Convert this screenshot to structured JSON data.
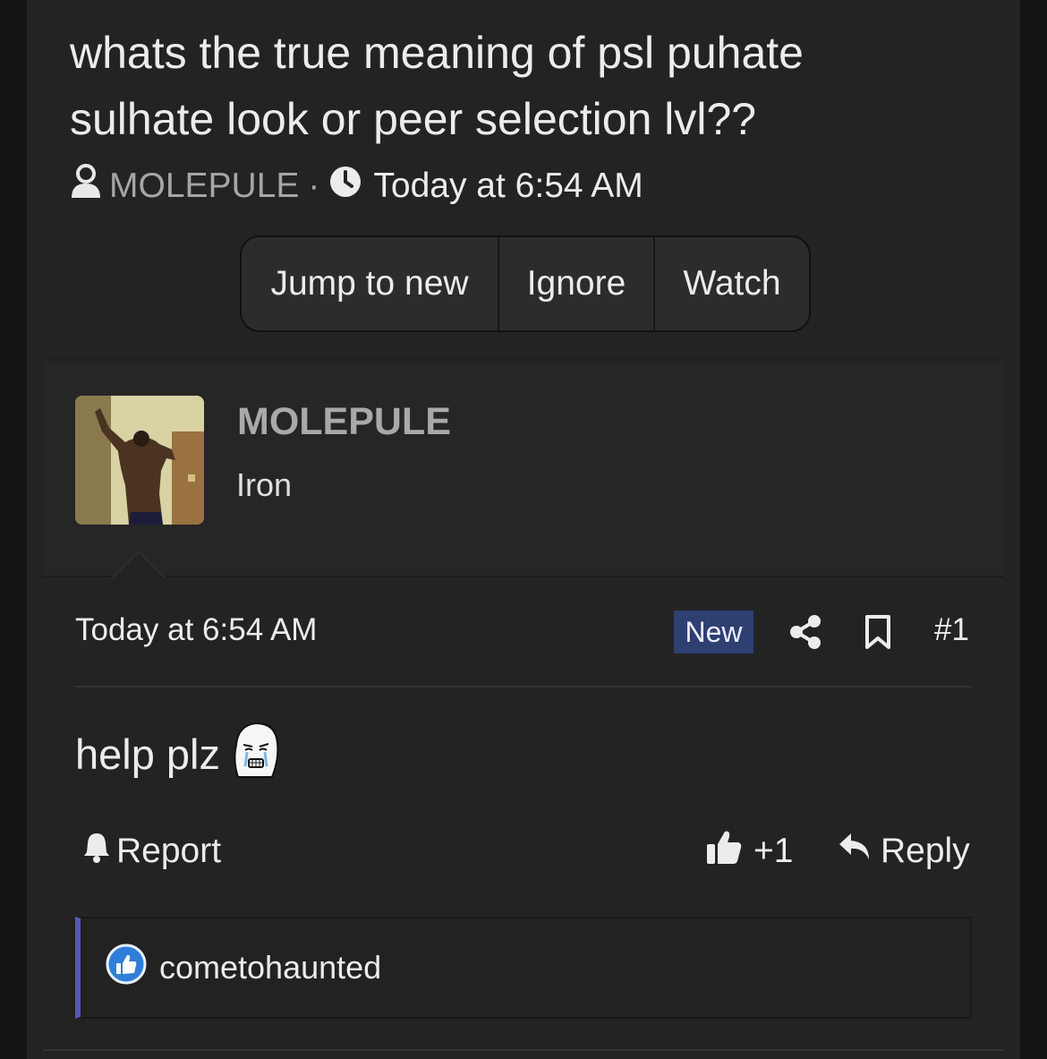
{
  "thread": {
    "title": "whats the true meaning of psl puhate sulhate look or peer selection lvl??",
    "author": "MOLEPULE",
    "separator": "·",
    "date": "Today at 6:54 AM"
  },
  "thread_buttons": {
    "jump_to_new": "Jump to new",
    "ignore": "Ignore",
    "watch": "Watch"
  },
  "poster": {
    "username": "MOLEPULE",
    "user_title": "Iron"
  },
  "post": {
    "date": "Today at 6:54 AM",
    "new_badge": "New",
    "number": "#1",
    "body": "help plz",
    "report_label": "Report",
    "like_label": "+1",
    "reply_label": "Reply"
  },
  "reactions": {
    "users": "cometohaunted"
  },
  "colors": {
    "background": "#232323",
    "new_badge": "#2e3f72",
    "reaction_accent": "#5459b6",
    "like_icon_blue": "#2f7ed8"
  },
  "icons": [
    "user-icon",
    "clock-icon",
    "share-icon",
    "bookmark-icon",
    "bell-icon",
    "thumbs-up-icon",
    "reply-icon",
    "like-reaction-icon",
    "crying-wojak-emoji"
  ]
}
